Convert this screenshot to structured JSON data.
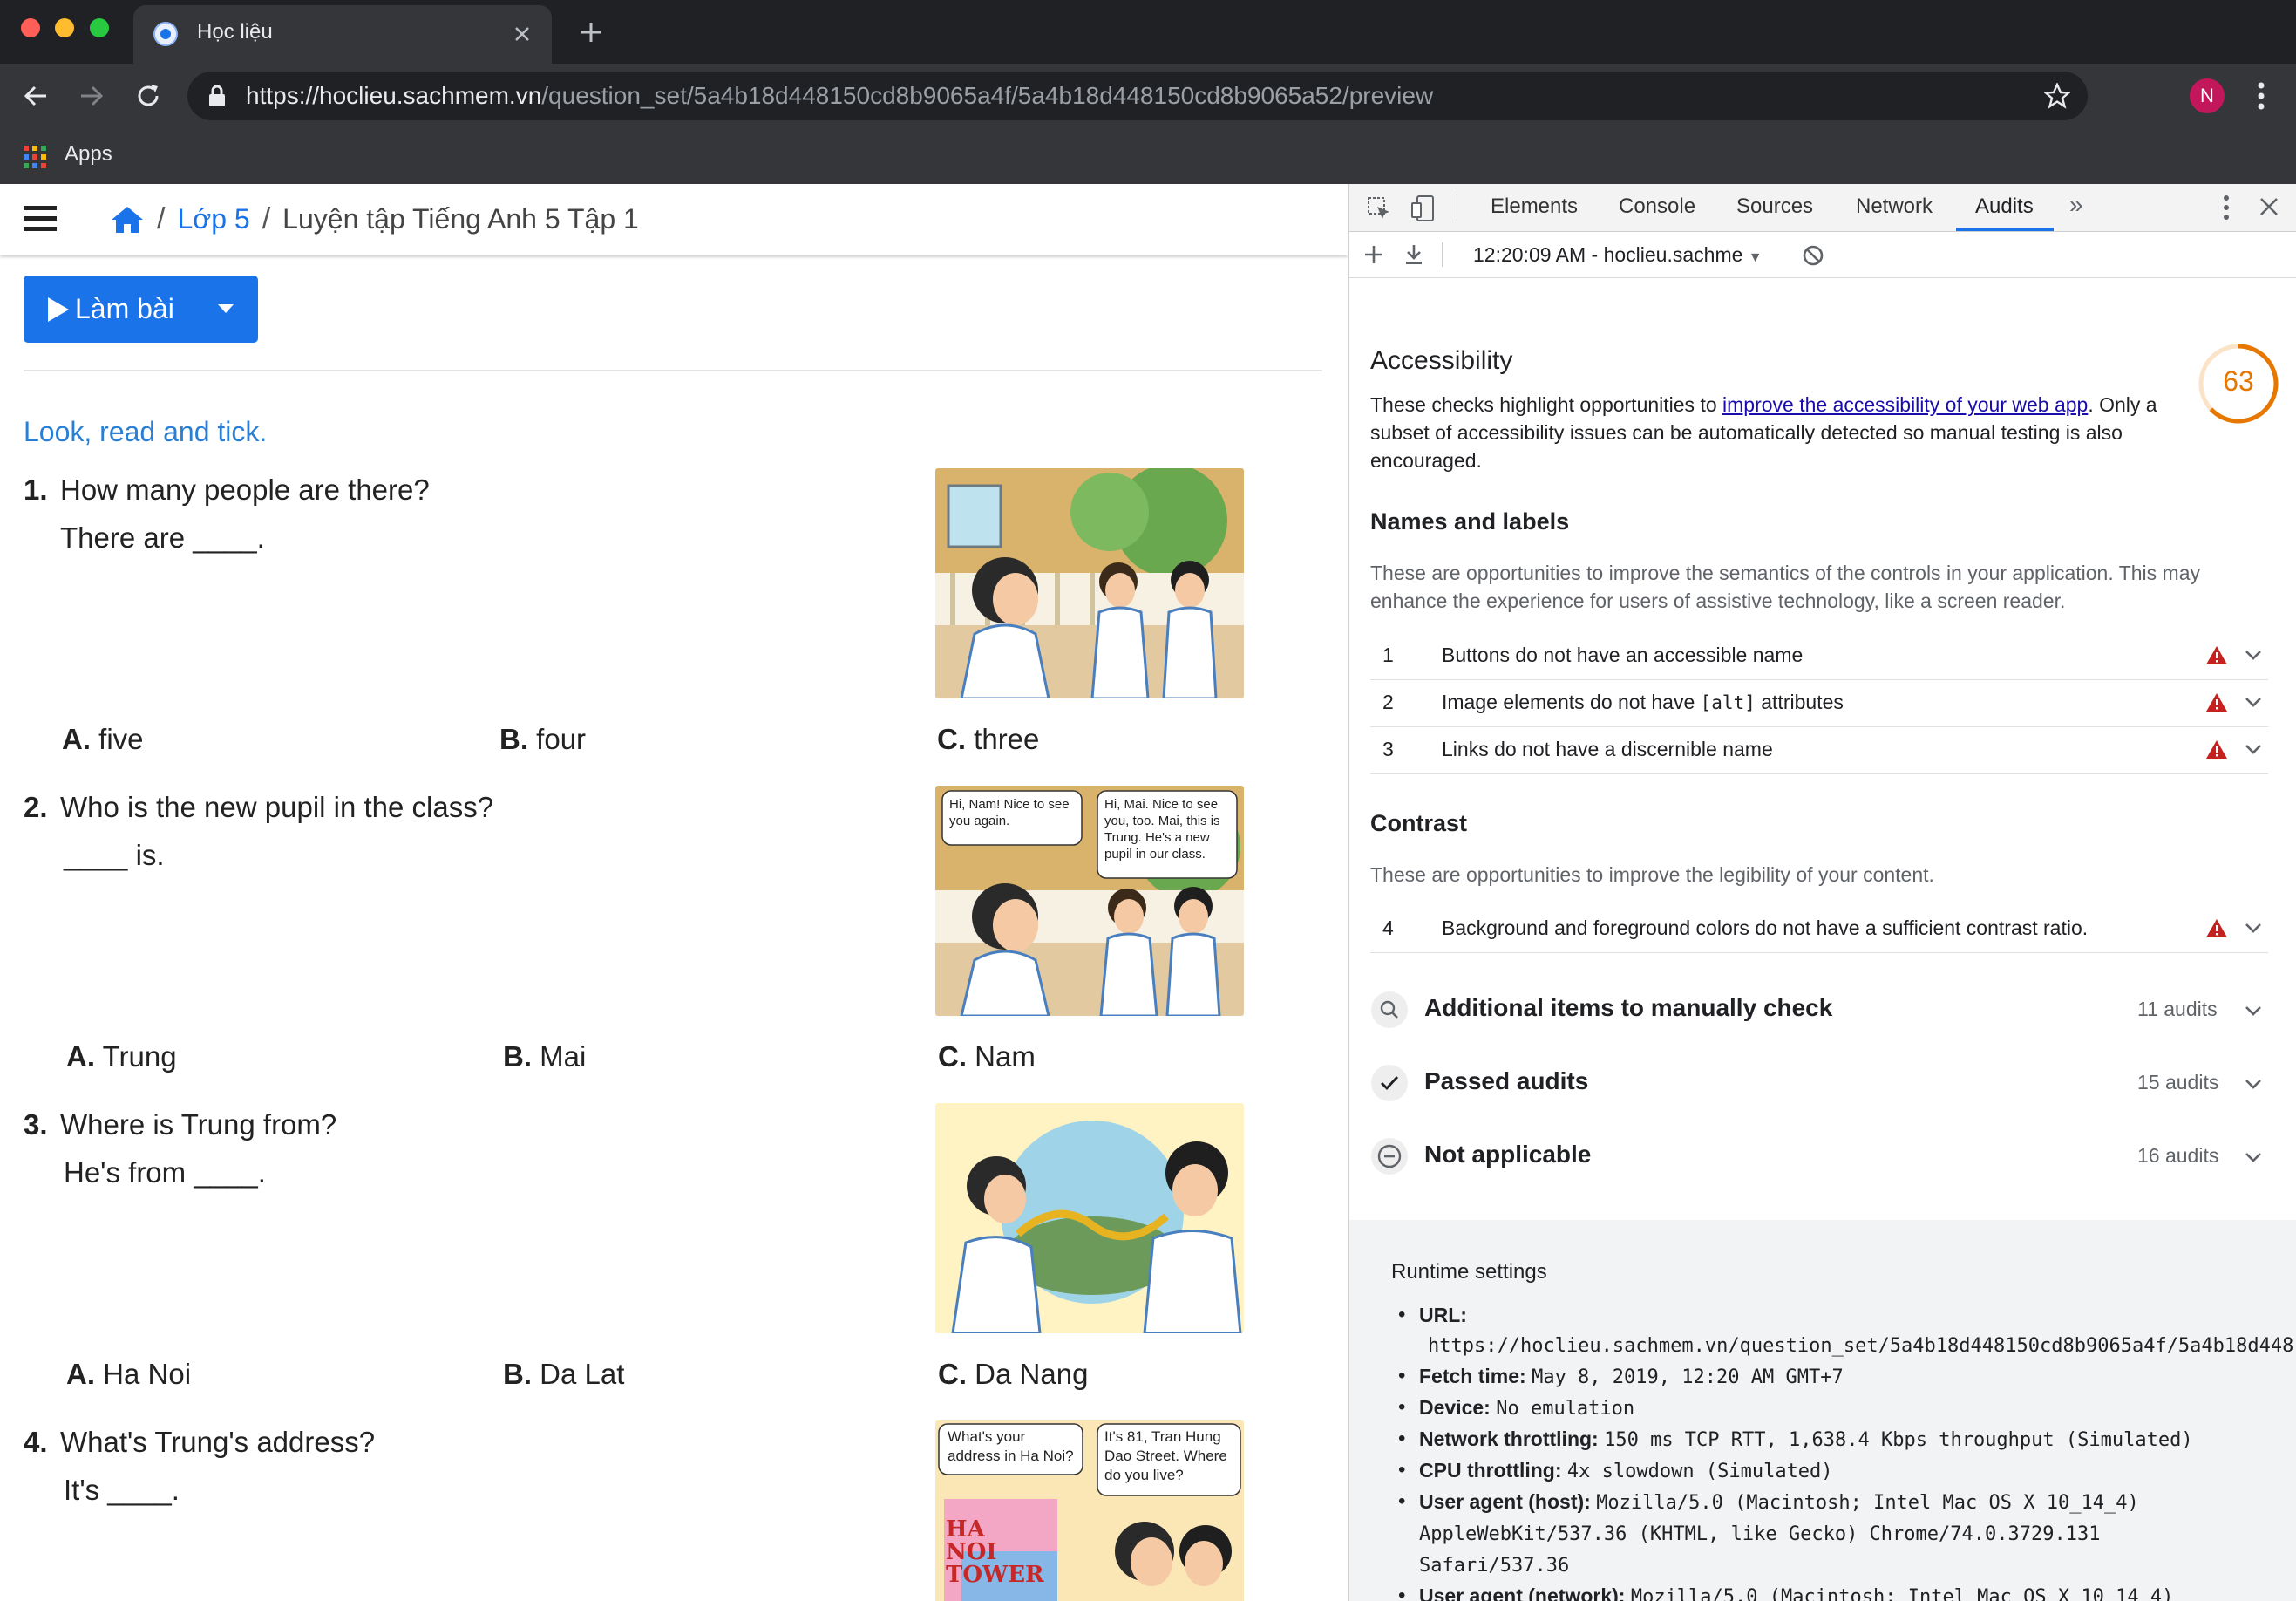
{
  "browser": {
    "tab_title": "Học liệu",
    "url_host": "https://hoclieu.sachmem.vn",
    "url_path": "/question_set/5a4b18d448150cd8b9065a4f/5a4b18d448150cd8b9065a52/preview",
    "bookmarks_apps": "Apps",
    "profile_initial": "N",
    "colors": {
      "frame": "#202124",
      "toolbar": "#35363a",
      "profile": "#c2185b",
      "extension": "#f29900"
    }
  },
  "page": {
    "breadcrumb": {
      "level": "Lớp 5",
      "current": "Luyện tập Tiếng Anh 5 Tập 1"
    },
    "start_button": "Làm bài",
    "instruction": "Look, read and tick.",
    "accent_color": "#1a73e8",
    "questions": [
      {
        "num": "1.",
        "question": "How many people are there?",
        "answer": "There are ____.",
        "options": [
          {
            "letter": "A.",
            "text": "five"
          },
          {
            "letter": "B.",
            "text": "four"
          },
          {
            "letter": "C.",
            "text": "three"
          }
        ]
      },
      {
        "num": "2.",
        "question": "Who is the new pupil in the class?",
        "answer": "____ is.",
        "bubble_left": "Hi, Nam! Nice to see you again.",
        "bubble_right": "Hi, Mai. Nice to see you, too. Mai, this is Trung. He's a new pupil in our class.",
        "options": [
          {
            "letter": "A.",
            "text": "Trung"
          },
          {
            "letter": "B.",
            "text": "Mai"
          },
          {
            "letter": "C.",
            "text": "Nam"
          }
        ]
      },
      {
        "num": "3.",
        "question": "Where is Trung from?",
        "answer": "He's from ____.",
        "options": [
          {
            "letter": "A.",
            "text": "Ha Noi"
          },
          {
            "letter": "B.",
            "text": "Da Lat"
          },
          {
            "letter": "C.",
            "text": "Da Nang"
          }
        ]
      },
      {
        "num": "4.",
        "question": "What's Trung's address?",
        "answer": "It's ____.",
        "bubble_left": "What's your address in Ha Noi?",
        "bubble_right": "It's 81, Tran Hung Dao Street. Where do you live?",
        "sign": "HA NOI TOWER"
      }
    ]
  },
  "devtools": {
    "tabs": [
      "Elements",
      "Console",
      "Sources",
      "Network",
      "Audits"
    ],
    "active_tab": "Audits",
    "report_selector": "12:20:09 AM - hoclieu.sachme",
    "category": {
      "title": "Accessibility",
      "score": 63,
      "score_color": "#e67700",
      "desc_before": "These checks highlight opportunities to ",
      "desc_link": "improve the accessibility of your web app",
      "desc_after": ". Only a subset of accessibility issues can be automatically detected so manual testing is also encouraged."
    },
    "groups": [
      {
        "title": "Names and labels",
        "desc": "These are opportunities to improve the semantics of the controls in your application. This may enhance the experience for users of assistive technology, like a screen reader.",
        "items": [
          {
            "n": "1",
            "text": "Buttons do not have an accessible name"
          },
          {
            "n": "2",
            "text_before": "Image elements do not have ",
            "code": "[alt]",
            "text_after": " attributes"
          },
          {
            "n": "3",
            "text": "Links do not have a discernible name"
          }
        ]
      },
      {
        "title": "Contrast",
        "desc": "These are opportunities to improve the legibility of your content.",
        "items": [
          {
            "n": "4",
            "text": "Background and foreground colors do not have a sufficient contrast ratio."
          }
        ]
      }
    ],
    "collapsed_groups": [
      {
        "label": "Additional items to manually check",
        "count": "11 audits",
        "icon": "search-icon"
      },
      {
        "label": "Passed audits",
        "count": "15 audits",
        "icon": "check-icon"
      },
      {
        "label": "Not applicable",
        "count": "16 audits",
        "icon": "minus-circle-icon"
      }
    ],
    "runtime": {
      "title": "Runtime settings",
      "url_label": "URL:",
      "url_value": "https://hoclieu.sachmem.vn/question_set/5a4b18d448150cd8b9065a4f/5a4b18d448",
      "fetch_label": "Fetch time:",
      "fetch_value": "May 8, 2019, 12:20 AM GMT+7",
      "device_label": "Device:",
      "device_value": "No emulation",
      "network_label": "Network throttling:",
      "network_value": "150 ms TCP RTT, 1,638.4 Kbps throughput (Simulated)",
      "cpu_label": "CPU throttling:",
      "cpu_value": "4x slowdown (Simulated)",
      "ua_host_label": "User agent (host):",
      "ua_host_value_1": "Mozilla/5.0 (Macintosh; Intel Mac OS X 10_14_4)",
      "ua_host_value_2": "AppleWebKit/537.36 (KHTML, like Gecko) Chrome/74.0.3729.131",
      "ua_host_value_3": "Safari/537.36",
      "ua_net_label": "User agent (network):",
      "ua_net_value": "Mozilla/5.0 (Macintosh; Intel Mac OS X 10_14_4)"
    },
    "warning_color": "#c5221f"
  }
}
